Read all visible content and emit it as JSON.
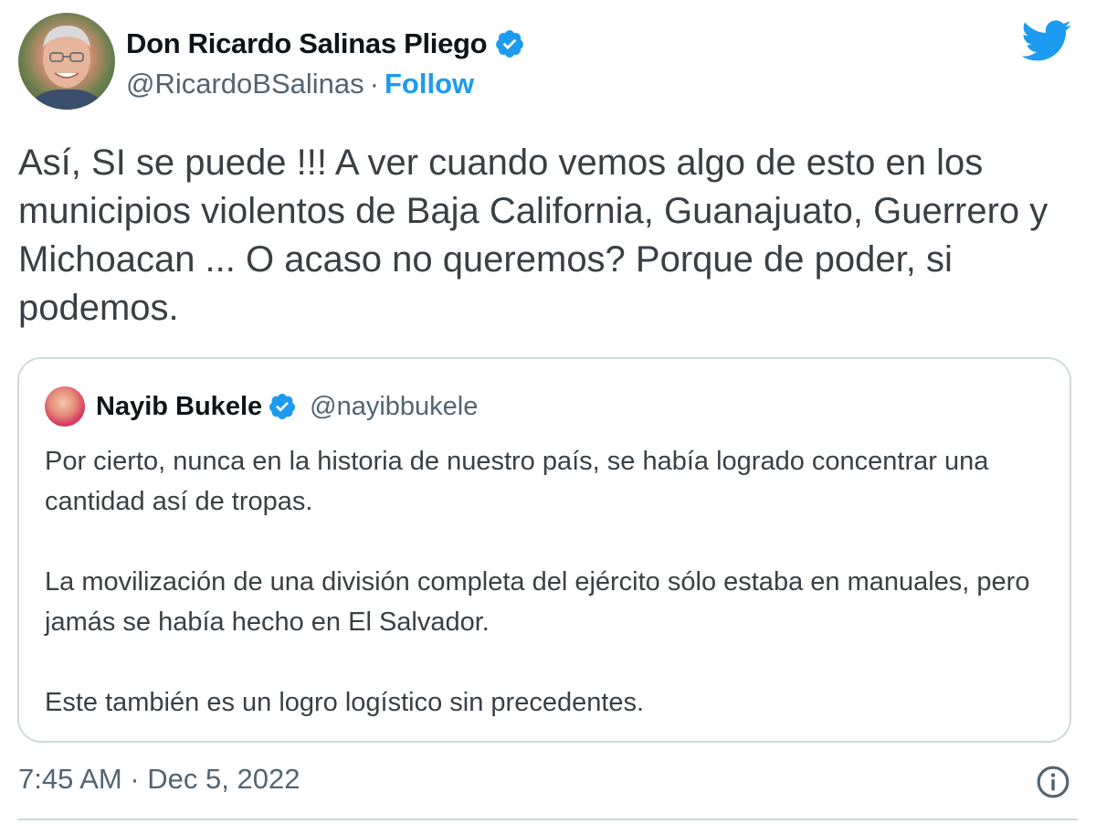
{
  "author": {
    "display_name": "Don Ricardo Salinas Pliego",
    "handle": "@RicardoBSalinas",
    "separator": "·",
    "follow_label": "Follow",
    "verified": true,
    "avatar_icon": "person-photo-avatar"
  },
  "tweet": {
    "text": "Así, SI se puede !!! A ver cuando vemos algo de esto en los municipios violentos de Baja California, Guanajuato, Guerrero y Michoacan ... O acaso no queremos? Porque de poder, si podemos."
  },
  "quoted_tweet": {
    "display_name": "Nayib Bukele",
    "handle": "@nayibbukele",
    "verified": true,
    "paragraphs": [
      "Por cierto, nunca en la historia de nuestro país, se había logrado concentrar una cantidad así de tropas.",
      "La movilización de una división completa del ejército sólo estaba en manuales, pero jamás se había hecho en El Salvador.",
      "Este también es un logro logístico sin precedentes."
    ]
  },
  "footer": {
    "timestamp": "7:45 AM · Dec 5, 2022",
    "info_icon": "info-icon"
  },
  "colors": {
    "accent": "#1d9bf0",
    "text_primary": "#0f1419",
    "text_secondary": "#536471",
    "border": "#cfd9de"
  }
}
